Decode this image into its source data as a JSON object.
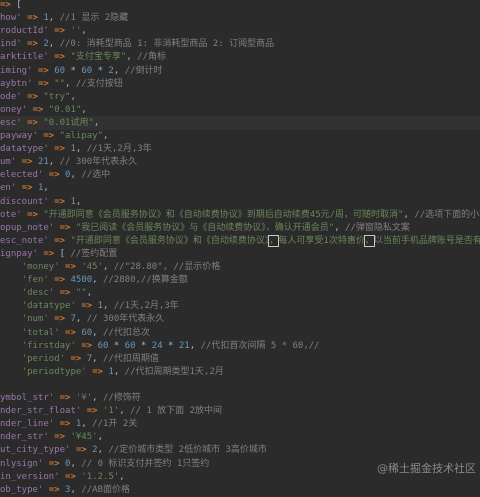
{
  "editor": {
    "lines": [
      {
        "parts": [
          [
            "a",
            "=>"
          ],
          [
            "p",
            " "
          ],
          [
            "p",
            "["
          ]
        ]
      },
      {
        "parts": [
          [
            "k",
            "how'"
          ],
          [
            "p",
            " "
          ],
          [
            "a",
            "=>"
          ],
          [
            "p",
            " "
          ],
          [
            "n",
            "1"
          ],
          [
            "p",
            ", "
          ],
          [
            "c",
            "//1 显示 2隐藏"
          ]
        ]
      },
      {
        "parts": [
          [
            "k",
            "roductId'"
          ],
          [
            "p",
            " "
          ],
          [
            "a",
            "=>"
          ],
          [
            "p",
            " "
          ],
          [
            "s",
            "''"
          ],
          [
            "p",
            ","
          ]
        ]
      },
      {
        "parts": [
          [
            "k",
            "ind'"
          ],
          [
            "p",
            " "
          ],
          [
            "a",
            "=>"
          ],
          [
            "p",
            " "
          ],
          [
            "n",
            "2"
          ],
          [
            "p",
            ", "
          ],
          [
            "c",
            "//0: 消耗型商品 1: 非消耗型商品 2: 订阅型商品"
          ]
        ]
      },
      {
        "parts": [
          [
            "k",
            "arktitle'"
          ],
          [
            "p",
            " "
          ],
          [
            "a",
            "=>"
          ],
          [
            "p",
            " "
          ],
          [
            "s",
            "\"支付宝专享\""
          ],
          [
            "p",
            ", "
          ],
          [
            "c",
            "//角标"
          ]
        ]
      },
      {
        "parts": [
          [
            "k",
            "iming'"
          ],
          [
            "p",
            " "
          ],
          [
            "a",
            "=>"
          ],
          [
            "p",
            " "
          ],
          [
            "n",
            "60"
          ],
          [
            "p",
            " * "
          ],
          [
            "n",
            "60"
          ],
          [
            "p",
            " * "
          ],
          [
            "n",
            "2"
          ],
          [
            "p",
            ", "
          ],
          [
            "c",
            "//倒计时"
          ]
        ]
      },
      {
        "parts": [
          [
            "k",
            "aybtn'"
          ],
          [
            "p",
            " "
          ],
          [
            "a",
            "=>"
          ],
          [
            "p",
            " "
          ],
          [
            "s",
            "\"\""
          ],
          [
            "p",
            ", "
          ],
          [
            "c",
            "//支付按钮"
          ]
        ]
      },
      {
        "parts": [
          [
            "k",
            "ode'"
          ],
          [
            "p",
            " "
          ],
          [
            "a",
            "=>"
          ],
          [
            "p",
            " "
          ],
          [
            "s",
            "\"try\""
          ],
          [
            "p",
            ","
          ]
        ]
      },
      {
        "parts": [
          [
            "k",
            "oney'"
          ],
          [
            "p",
            " "
          ],
          [
            "a",
            "=>"
          ],
          [
            "p",
            " "
          ],
          [
            "s",
            "\"0.01\""
          ],
          [
            "p",
            ","
          ]
        ]
      },
      {
        "hl": true,
        "parts": [
          [
            "k",
            "esc'"
          ],
          [
            "p",
            " "
          ],
          [
            "a",
            "=>"
          ],
          [
            "p",
            " "
          ],
          [
            "s",
            "\"0.01试用\""
          ],
          [
            "p",
            ","
          ]
        ]
      },
      {
        "parts": [
          [
            "k",
            "payway'"
          ],
          [
            "p",
            " "
          ],
          [
            "a",
            "=>"
          ],
          [
            "p",
            " "
          ],
          [
            "s",
            "\"alipay\""
          ],
          [
            "p",
            ","
          ]
        ]
      },
      {
        "parts": [
          [
            "k",
            "datatype'"
          ],
          [
            "p",
            " "
          ],
          [
            "a",
            "=>"
          ],
          [
            "p",
            " "
          ],
          [
            "n",
            "1"
          ],
          [
            "p",
            ", "
          ],
          [
            "c",
            "//1天,2月,3年"
          ]
        ]
      },
      {
        "parts": [
          [
            "k",
            "um'"
          ],
          [
            "p",
            " "
          ],
          [
            "a",
            "=>"
          ],
          [
            "p",
            " "
          ],
          [
            "n",
            "21"
          ],
          [
            "p",
            ", "
          ],
          [
            "c",
            "// 300年代表永久"
          ]
        ]
      },
      {
        "parts": [
          [
            "k",
            "elected'"
          ],
          [
            "p",
            " "
          ],
          [
            "a",
            "=>"
          ],
          [
            "p",
            " "
          ],
          [
            "n",
            "0"
          ],
          [
            "p",
            ", "
          ],
          [
            "c",
            "//选中"
          ]
        ]
      },
      {
        "parts": [
          [
            "k",
            "en'"
          ],
          [
            "p",
            " "
          ],
          [
            "a",
            "=>"
          ],
          [
            "p",
            " "
          ],
          [
            "n",
            "1"
          ],
          [
            "p",
            ","
          ]
        ]
      },
      {
        "parts": [
          [
            "k",
            "discount'"
          ],
          [
            "p",
            " "
          ],
          [
            "a",
            "=>"
          ],
          [
            "p",
            " "
          ],
          [
            "n",
            "1"
          ],
          [
            "p",
            ","
          ]
        ]
      },
      {
        "parts": [
          [
            "k",
            "ote'"
          ],
          [
            "p",
            " "
          ],
          [
            "a",
            "=>"
          ],
          [
            "p",
            " "
          ],
          [
            "s",
            "\"开通即同意《会员服务协议》和《自动续费协议》到期后自动续费45元/周，可随时取消\""
          ],
          [
            "p",
            ", "
          ],
          [
            "c",
            "//选项下面的小字"
          ]
        ]
      },
      {
        "parts": [
          [
            "k",
            "opup_note'"
          ],
          [
            "p",
            " "
          ],
          [
            "a",
            "=>"
          ],
          [
            "p",
            " "
          ],
          [
            "s",
            "\"我已阅读《会员服务协议》与《自动续费协议》，确认开通会员\""
          ],
          [
            "p",
            ", "
          ],
          [
            "c",
            "//弹窗隐私文案"
          ]
        ]
      },
      {
        "parts": [
          [
            "k",
            "esc_note'"
          ],
          [
            "p",
            " "
          ],
          [
            "a",
            "=>"
          ],
          [
            "p",
            " "
          ],
          [
            "s",
            "\"开通即同意《会员服务协议》和《自动续费协议》"
          ],
          [
            "sbox",
            "，"
          ],
          [
            "s",
            "每人可享受1次特惠价"
          ],
          [
            "sbox",
            "，"
          ],
          [
            "s",
            "以当前手机品牌账号是否有相"
          ]
        ]
      },
      {
        "parts": [
          [
            "k",
            "ignpay'"
          ],
          [
            "p",
            " "
          ],
          [
            "a",
            "=>"
          ],
          [
            "p",
            " [ "
          ],
          [
            "c",
            "//签约配置"
          ]
        ]
      },
      {
        "parts": [
          [
            "p",
            "    "
          ],
          [
            "s",
            "'money'"
          ],
          [
            "p",
            " "
          ],
          [
            "a",
            "=>"
          ],
          [
            "p",
            " "
          ],
          [
            "s",
            "'45'"
          ],
          [
            "p",
            ", "
          ],
          [
            "c",
            "//\"28.80\", //显示价格"
          ]
        ]
      },
      {
        "parts": [
          [
            "p",
            "    "
          ],
          [
            "s",
            "'fen'"
          ],
          [
            "p",
            " "
          ],
          [
            "a",
            "=>"
          ],
          [
            "p",
            " "
          ],
          [
            "n",
            "4500"
          ],
          [
            "p",
            ", "
          ],
          [
            "c",
            "//2880,//换算金额"
          ]
        ]
      },
      {
        "parts": [
          [
            "p",
            "    "
          ],
          [
            "s",
            "'desc'"
          ],
          [
            "p",
            " "
          ],
          [
            "a",
            "=>"
          ],
          [
            "p",
            " "
          ],
          [
            "s",
            "\"\""
          ],
          [
            "p",
            ","
          ]
        ]
      },
      {
        "parts": [
          [
            "p",
            "    "
          ],
          [
            "s",
            "'datatype'"
          ],
          [
            "p",
            " "
          ],
          [
            "a",
            "=>"
          ],
          [
            "p",
            " "
          ],
          [
            "n",
            "1"
          ],
          [
            "p",
            ", "
          ],
          [
            "c",
            "//1天,2月,3年"
          ]
        ]
      },
      {
        "parts": [
          [
            "p",
            "    "
          ],
          [
            "s",
            "'num'"
          ],
          [
            "p",
            " "
          ],
          [
            "a",
            "=>"
          ],
          [
            "p",
            " "
          ],
          [
            "n",
            "7"
          ],
          [
            "p",
            ", "
          ],
          [
            "c",
            "// 300年代表永久"
          ]
        ]
      },
      {
        "parts": [
          [
            "p",
            "    "
          ],
          [
            "s",
            "'total'"
          ],
          [
            "p",
            " "
          ],
          [
            "a",
            "=>"
          ],
          [
            "p",
            " "
          ],
          [
            "n",
            "60"
          ],
          [
            "p",
            ", "
          ],
          [
            "c",
            "//代扣总次"
          ]
        ]
      },
      {
        "parts": [
          [
            "p",
            "    "
          ],
          [
            "s",
            "'firstday'"
          ],
          [
            "p",
            " "
          ],
          [
            "a",
            "=>"
          ],
          [
            "p",
            " "
          ],
          [
            "n",
            "60"
          ],
          [
            "p",
            " * "
          ],
          [
            "n",
            "60"
          ],
          [
            "p",
            " * "
          ],
          [
            "n",
            "24"
          ],
          [
            "p",
            " * "
          ],
          [
            "n",
            "21"
          ],
          [
            "p",
            ", "
          ],
          [
            "c",
            "//代扣首次间隔 5 * 60,//"
          ]
        ]
      },
      {
        "parts": [
          [
            "p",
            "    "
          ],
          [
            "s",
            "'period'"
          ],
          [
            "p",
            " "
          ],
          [
            "a",
            "=>"
          ],
          [
            "p",
            " "
          ],
          [
            "n",
            "7"
          ],
          [
            "p",
            ", "
          ],
          [
            "c",
            "//代扣周期值"
          ]
        ]
      },
      {
        "parts": [
          [
            "p",
            "    "
          ],
          [
            "s",
            "'periodtype'"
          ],
          [
            "p",
            " "
          ],
          [
            "a",
            "=>"
          ],
          [
            "p",
            " "
          ],
          [
            "n",
            "1"
          ],
          [
            "p",
            ", "
          ],
          [
            "c",
            "//代扣周期类型1天,2月"
          ]
        ]
      },
      {
        "parts": [
          [
            "p",
            ""
          ]
        ]
      },
      {
        "parts": [
          [
            "k",
            "ymbol_str'"
          ],
          [
            "p",
            " "
          ],
          [
            "a",
            "=>"
          ],
          [
            "p",
            " "
          ],
          [
            "s",
            "'¥'"
          ],
          [
            "p",
            ", "
          ],
          [
            "c",
            "//修饰符"
          ]
        ]
      },
      {
        "parts": [
          [
            "k",
            "nder_str_float'"
          ],
          [
            "p",
            " "
          ],
          [
            "a",
            "=>"
          ],
          [
            "p",
            " "
          ],
          [
            "s",
            "'1'"
          ],
          [
            "p",
            ", "
          ],
          [
            "c",
            "// 1 放下面 2放中间"
          ]
        ]
      },
      {
        "parts": [
          [
            "k",
            "nder_line'"
          ],
          [
            "p",
            " "
          ],
          [
            "a",
            "=>"
          ],
          [
            "p",
            " "
          ],
          [
            "n",
            "1"
          ],
          [
            "p",
            ", "
          ],
          [
            "c",
            "//1开 2关"
          ]
        ]
      },
      {
        "parts": [
          [
            "k",
            "nder_str'"
          ],
          [
            "p",
            " "
          ],
          [
            "a",
            "=>"
          ],
          [
            "p",
            " "
          ],
          [
            "s",
            "'¥45'"
          ],
          [
            "p",
            ","
          ]
        ]
      },
      {
        "parts": [
          [
            "k",
            "ut_city_type'"
          ],
          [
            "p",
            " "
          ],
          [
            "a",
            "=>"
          ],
          [
            "p",
            " "
          ],
          [
            "n",
            "2"
          ],
          [
            "p",
            ", "
          ],
          [
            "c",
            "//定价城市类型 2低价城市 3高价城市"
          ]
        ]
      },
      {
        "parts": [
          [
            "k",
            "nlysign'"
          ],
          [
            "p",
            " "
          ],
          [
            "a",
            "=>"
          ],
          [
            "p",
            " "
          ],
          [
            "n",
            "0"
          ],
          [
            "p",
            ", "
          ],
          [
            "c",
            "// 0 标识支付并签约 1只签约"
          ]
        ]
      },
      {
        "parts": [
          [
            "k",
            "in_version'"
          ],
          [
            "p",
            " "
          ],
          [
            "a",
            "=>"
          ],
          [
            "p",
            " "
          ],
          [
            "s",
            "'1.2.5'"
          ],
          [
            "p",
            ","
          ]
        ]
      },
      {
        "parts": [
          [
            "k",
            "ob_type'"
          ],
          [
            "p",
            " "
          ],
          [
            "a",
            "=>"
          ],
          [
            "p",
            " "
          ],
          [
            "n",
            "3"
          ],
          [
            "p",
            ", "
          ],
          [
            "c",
            "//AB面价格"
          ]
        ]
      }
    ]
  },
  "colors": {
    "background": "#2b2b2b",
    "highlight_line": "#323232",
    "key": "#9876aa",
    "operator": "#cc7832",
    "number": "#6897bb",
    "string": "#6a8759",
    "comment": "#808080",
    "plain": "#a9b7c6"
  },
  "watermark": "@稀土掘金技术社区"
}
